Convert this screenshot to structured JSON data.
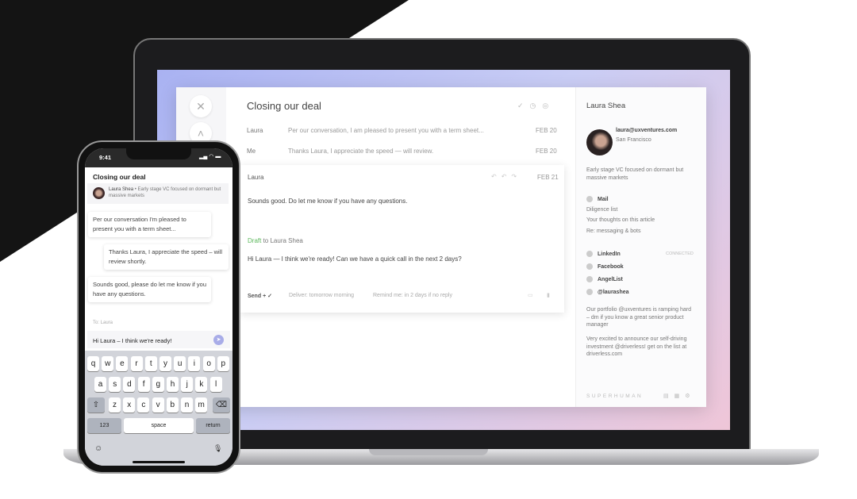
{
  "email": {
    "subject": "Closing our deal",
    "thread": [
      {
        "from": "Laura",
        "preview": "Per our conversation, I am pleased to present you with a term sheet...",
        "date": "FEB 20"
      },
      {
        "from": "Me",
        "preview": "Thanks Laura, I appreciate the speed — will review.",
        "date": "FEB 20"
      }
    ],
    "open": {
      "from": "Laura",
      "date": "FEB 21",
      "body": "Sounds good.  Do let me know if you have any questions.",
      "draft_label": "Draft",
      "draft_to": "to Laura Shea",
      "draft_body": "Hi Laura — I think we're ready! Can we have a quick call in the next 2 days?",
      "send": "Send",
      "deliver": "Deliver: tomorrow morning",
      "remind": "Remind me: in 2 days if no reply"
    }
  },
  "contact": {
    "name": "Laura Shea",
    "email": "laura@uxventures.com",
    "location": "San Francisco",
    "bio": "Early stage VC focused on dormant but massive markets",
    "mail_label": "Mail",
    "mail_items": [
      "Diligence list",
      "Your thoughts on this article",
      "Re: messaging & bots"
    ],
    "social": [
      {
        "label": "LinkedIn",
        "status": "CONNECTED"
      },
      {
        "label": "Facebook"
      },
      {
        "label": "AngelList"
      },
      {
        "label": "@laurashea"
      }
    ],
    "tweets": [
      "Our portfolio @uxventures is ramping hard – dm if you know a great senior product manager",
      "Very excited to announce our self-driving investment @driverless! get on the list at driverless.com"
    ],
    "brand": "SUPERHUMAN"
  },
  "phone": {
    "time": "9:41",
    "title": "Closing our deal",
    "sender": "Laura Shea",
    "sender_bio": "Early stage VC focused on dormant but massive markets",
    "messages": [
      "Per our conversation I'm pleased to present you with a term sheet...",
      "Thanks Laura, I appreciate the speed – will review shortly.",
      "Sounds good, please do let me know if you have any questions."
    ],
    "to": "To: Laura",
    "compose": "Hi Laura – I think we're ready!",
    "keys": {
      "row1": [
        "q",
        "w",
        "e",
        "r",
        "t",
        "y",
        "u",
        "i",
        "o",
        "p"
      ],
      "row2": [
        "a",
        "s",
        "d",
        "f",
        "g",
        "h",
        "j",
        "k",
        "l"
      ],
      "row3": [
        "z",
        "x",
        "c",
        "v",
        "b",
        "n",
        "m"
      ],
      "num": "123",
      "space": "space",
      "return": "return"
    }
  },
  "colors": {
    "draft": "#5cb85c",
    "accent": "#a8ace8"
  }
}
